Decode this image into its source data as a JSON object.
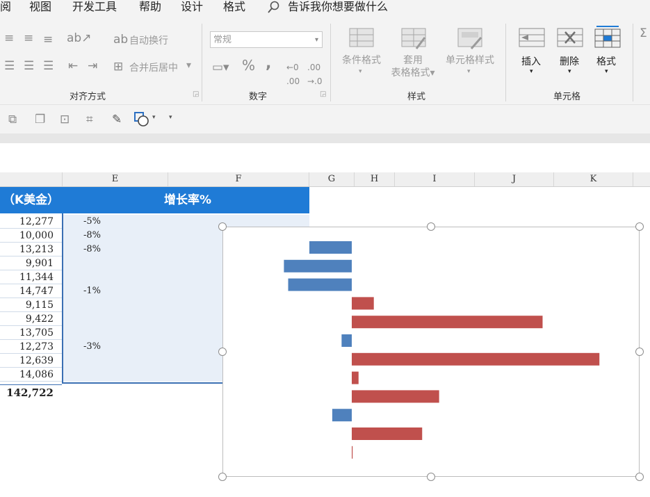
{
  "menu": [
    "阅",
    "视图",
    "开发工具",
    "帮助",
    "设计",
    "格式"
  ],
  "tell_me": "告诉我你想要做什么",
  "ribbon": {
    "wrap_text": "自动换行",
    "merge_center": "合并后居中",
    "alignment_group": "对齐方式",
    "number_format": "常规",
    "number_group": "数字",
    "conditional_format": "条件格式",
    "format_as_table": [
      "套用",
      "表格格式"
    ],
    "cell_styles": "单元格样式",
    "styles_group": "样式",
    "insert": "插入",
    "delete": "删除",
    "format": "格式",
    "cells_group": "单元格"
  },
  "columns": [
    "E",
    "F",
    "G",
    "H",
    "I",
    "J",
    "K"
  ],
  "table": {
    "header_d": "（K美金）",
    "header_ef": "增长率%",
    "rows": [
      {
        "d": "12,277",
        "e": "-5%"
      },
      {
        "d": "10,000",
        "e": "-8%"
      },
      {
        "d": "13,213",
        "e": "-8%"
      },
      {
        "d": "9,901",
        "e": ""
      },
      {
        "d": "11,344",
        "e": ""
      },
      {
        "d": "14,747",
        "e": "-1%"
      },
      {
        "d": "9,115",
        "e": ""
      },
      {
        "d": "9,422",
        "e": ""
      },
      {
        "d": "13,705",
        "e": ""
      },
      {
        "d": "12,273",
        "e": "-3%"
      },
      {
        "d": "12,639",
        "e": ""
      },
      {
        "d": "14,086",
        "e": ""
      }
    ],
    "total": "142,722"
  },
  "colors": {
    "negative": "#4f81bd",
    "positive": "#c0504d",
    "header_blue": "#1f7bd6"
  },
  "chart_data": {
    "type": "bar",
    "orientation": "horizontal",
    "title": "",
    "values": [
      -5,
      -8,
      -7.5,
      2.6,
      22.5,
      -1.2,
      29.2,
      0.8,
      10.3,
      -2.3,
      8.3,
      0.1
    ]
  }
}
